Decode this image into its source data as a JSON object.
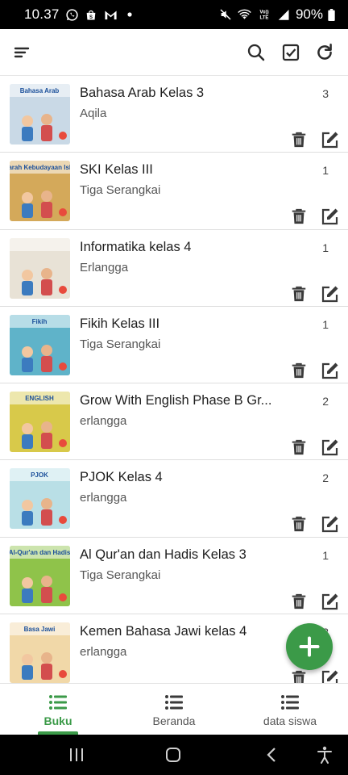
{
  "status_bar": {
    "time": "10.37",
    "battery": "90%",
    "icons": [
      "whatsapp-icon",
      "shopee-icon",
      "gmail-icon",
      "dot-icon",
      "mute-icon",
      "wifi-icon",
      "volte-icon",
      "signal-icon",
      "battery-icon"
    ]
  },
  "app_bar": {
    "icons": [
      "sort-icon",
      "search-icon",
      "checkbox-icon",
      "refresh-icon"
    ]
  },
  "books": [
    {
      "title": "Bahasa Arab Kelas 3",
      "publisher": "Aqila",
      "qty": "3",
      "cover_label": "Bahasa Arab",
      "cover_color": "#c9d9e6"
    },
    {
      "title": "SKI Kelas III",
      "publisher": "Tiga Serangkai",
      "qty": "1",
      "cover_label": "Sejarah Kebudayaan Islam",
      "cover_color": "#d4a95a"
    },
    {
      "title": "Informatika kelas 4",
      "publisher": "Erlangga",
      "qty": "1",
      "cover_label": "",
      "cover_color": "#e8e2d6"
    },
    {
      "title": "Fikih Kelas III",
      "publisher": "Tiga Serangkai",
      "qty": "1",
      "cover_label": "Fikih",
      "cover_color": "#5fb3c9"
    },
    {
      "title": "Grow With English Phase B Gr...",
      "publisher": "erlangga",
      "qty": "2",
      "cover_label": "ENGLISH",
      "cover_color": "#d8c94a"
    },
    {
      "title": "PJOK Kelas 4",
      "publisher": "erlangga",
      "qty": "2",
      "cover_label": "PJOK",
      "cover_color": "#b9dfe6"
    },
    {
      "title": "Al Qur'an dan Hadis Kelas 3",
      "publisher": "Tiga Serangkai",
      "qty": "1",
      "cover_label": "Al-Qur'an dan Hadis",
      "cover_color": "#8fc34a"
    },
    {
      "title": "Kemen Bahasa Jawi kelas 4",
      "publisher": "erlangga",
      "qty": "3",
      "cover_label": "Basa Jawi",
      "cover_color": "#f1d8a8"
    }
  ],
  "fab": {
    "icon": "plus-icon"
  },
  "bottom_nav": {
    "items": [
      {
        "label": "Buku",
        "active": true
      },
      {
        "label": "Beranda",
        "active": false
      },
      {
        "label": "data siswa",
        "active": false
      }
    ]
  },
  "colors": {
    "accent": "#3b9a48",
    "icon": "#2b2b2b"
  }
}
